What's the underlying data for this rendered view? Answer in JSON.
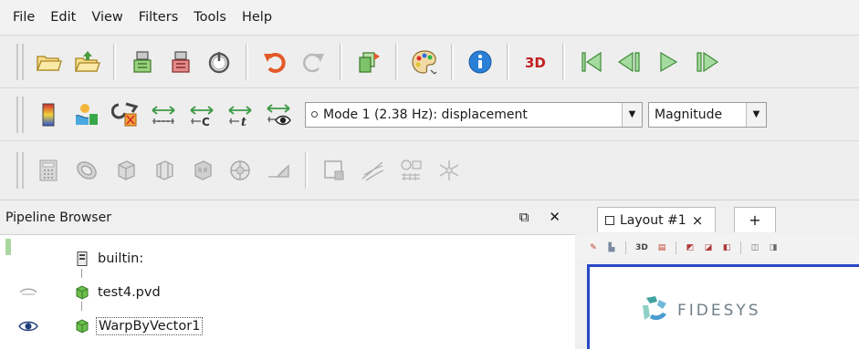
{
  "menu": [
    "File",
    "Edit",
    "View",
    "Filters",
    "Tools",
    "Help"
  ],
  "toolbar_main": {
    "icons": [
      "open-icon",
      "load-state-icon",
      "connect-icon",
      "disconnect-icon",
      "reset-session-icon",
      "undo-icon",
      "redo-icon",
      "save-data-icon",
      "color-palette-icon",
      "info-icon",
      "3d-icon",
      "first-frame-icon",
      "previous-frame-icon",
      "play-icon",
      "next-frame-icon"
    ],
    "label_3d": "3D"
  },
  "toolbar_color": {
    "mode_select": "Mode 1 (2.38 Hz): displacement",
    "component_select": "Magnitude"
  },
  "pipeline_browser": {
    "title": "Pipeline Browser",
    "items": [
      {
        "label": "builtin:",
        "visible": null
      },
      {
        "label": "test4.pvd",
        "visible": false
      },
      {
        "label": "WarpByVector1",
        "visible": true
      }
    ]
  },
  "layout": {
    "tab_label": "Layout #1",
    "close_glyph": "×",
    "add_tab": "+",
    "mini_toolbar_3d": "3D",
    "logo_text": "FIDESYS"
  },
  "colors": {
    "viewport_border": "#2847c4",
    "node_green": "#5cab3c",
    "logo_teal": "#3fa3a0"
  }
}
